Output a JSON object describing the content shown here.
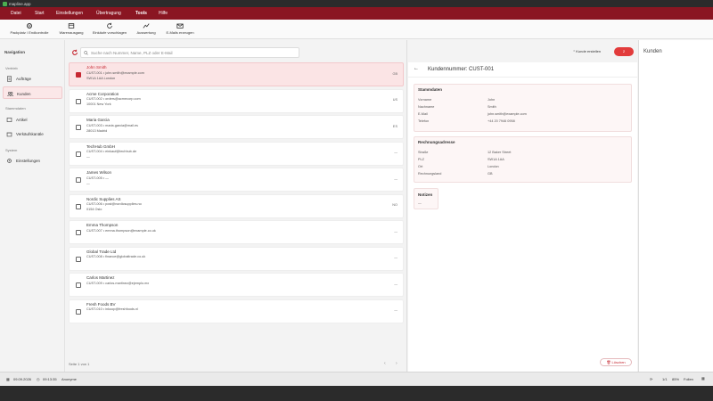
{
  "app": {
    "title": "mapline.app"
  },
  "menubar": {
    "items": [
      "Datei",
      "Start",
      "Einstellungen",
      "Übertragung",
      "Tools",
      "Hilfe"
    ],
    "active": "Tools"
  },
  "ribbon": {
    "buttons": [
      "Packplatz / Endkontrolle",
      "Warenausgang",
      "Einkäufe vorschlagen",
      "Auswertung",
      "E-Mails erzeugen"
    ]
  },
  "sidebar": {
    "title": "Navigation",
    "groups": [
      {
        "label": "Vertrieb",
        "items": [
          "Aufträge",
          "Kunden"
        ]
      },
      {
        "label": "Stammdaten",
        "items": [
          "Artikel",
          "Verkäufskanäle"
        ]
      },
      {
        "label": "System",
        "items": [
          "Einstellungen"
        ]
      }
    ],
    "active": "Kunden"
  },
  "list": {
    "search_placeholder": "Suche nach Nummer, Name, PLZ oder E-Mail",
    "create_label": "Kunde erstellen",
    "badge": "2",
    "footer": "Seite 1 von 1",
    "rows": [
      {
        "name": "John Smith",
        "line2": "CUST-001 • john.smith@example.com",
        "line3": "SW1A 1AA London",
        "right": "GB",
        "selected": true
      },
      {
        "name": "Acme Corporation",
        "line2": "CUST-002 • orders@acmecorp.com",
        "line3": "10001 New York",
        "right": "US",
        "selected": false
      },
      {
        "name": "Maria Garcia",
        "line2": "CUST-003 • maria.garcia@mail.es",
        "line3": "28013 Madrid",
        "right": "ES",
        "selected": false
      },
      {
        "name": "TechHub GmbH",
        "line2": "CUST-004 • einkauf@techhub.de",
        "line3": "—",
        "right": "—",
        "selected": false
      },
      {
        "name": "James Wilson",
        "line2": "CUST-005 • —",
        "line3": "—",
        "right": "—",
        "selected": false
      },
      {
        "name": "Nordic Supplies AS",
        "line2": "CUST-006 • post@nordicsupplies.no",
        "line3": "0154 Oslo",
        "right": "NO",
        "selected": false
      },
      {
        "name": "Emma Thompson",
        "line2": "CUST-007 • emma.thompson@example.co.uk",
        "line3": "",
        "right": "—",
        "selected": false
      },
      {
        "name": "Global Trade Ltd",
        "line2": "CUST-008 • finance@globaltrade.co.uk",
        "line3": "",
        "right": "—",
        "selected": false
      },
      {
        "name": "Carlos Martinez",
        "line2": "CUST-009 • carlos.martinez@ejemplo.mx",
        "line3": "",
        "right": "—",
        "selected": false
      },
      {
        "name": "Fresh Foods BV",
        "line2": "CUST-010 • inkoop@freshfoods.nl",
        "line3": "",
        "right": "—",
        "selected": false
      }
    ]
  },
  "detail": {
    "title": "Kundennummer: CUST-001",
    "stammdaten": {
      "heading": "Stammdaten",
      "fields": [
        {
          "label": "Vorname",
          "value": "John"
        },
        {
          "label": "Nachname",
          "value": "Smith"
        },
        {
          "label": "E-Mail",
          "value": "john.smith@example.com"
        },
        {
          "label": "Telefon",
          "value": "+44 20 7946 0958"
        }
      ]
    },
    "rechnung": {
      "heading": "Rechnungsadresse",
      "fields": [
        {
          "label": "Straße",
          "value": "12 Baker Street"
        },
        {
          "label": "PLZ",
          "value": "SW1A 1AA"
        },
        {
          "label": "Ort",
          "value": "London"
        },
        {
          "label": "Rechnungsland",
          "value": "GB"
        }
      ]
    },
    "notizen": {
      "heading": "Notizen",
      "value": "—"
    },
    "delete_label": "Löschen"
  },
  "rightpanel": {
    "title": "Kunden"
  },
  "statusbar": {
    "date": "09.09.2026",
    "time": "09:13:35",
    "user": "Anonyme",
    "page": "1/1",
    "zoom": "85%",
    "mode": "Folien"
  },
  "colors": {
    "accent": "#8a1622",
    "selected": "#c62832"
  }
}
